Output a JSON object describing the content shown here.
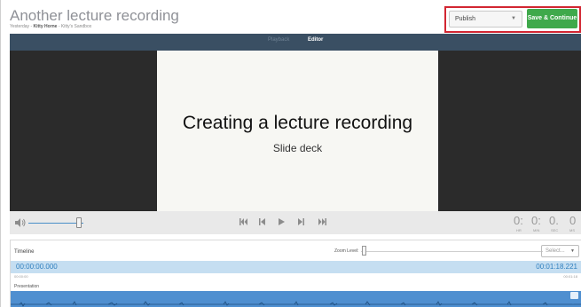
{
  "header": {
    "title": "Another lecture recording",
    "meta_when": "Yesterday",
    "meta_sep1": " - ",
    "meta_author": "Kitty Horne",
    "meta_sep2": " - ",
    "meta_folder": "Kitty's Sandbox"
  },
  "actions": {
    "publish_value": "Publish",
    "save_label": "Save & Continue"
  },
  "player": {
    "tabs": [
      "Playback",
      "Editor"
    ],
    "active_tab": "Editor",
    "slide_title": "Creating a lecture recording",
    "slide_subtitle": "Slide deck"
  },
  "controls": {
    "volume_level": 0.92,
    "time_hr": "0:",
    "time_min": "0:",
    "time_sec": "0.",
    "time_ms": "0",
    "label_hr": "HR",
    "label_min": "MIN",
    "label_sec": "SEC",
    "label_ms": "MS"
  },
  "timeline": {
    "label": "Timeline",
    "zoom_label": "Zoom Level:",
    "zoom_level": 0.0,
    "select_placeholder": "Select...",
    "start_time": "00:00:00.000",
    "end_time": "00:01:18.221",
    "start_small": "00:00:00",
    "end_small": "00:01:18",
    "presentation_label": "Presentation"
  },
  "colors": {
    "highlight_box": "#d22632",
    "save_button": "#3fa94b",
    "mode_bar": "#3a4f63",
    "timeline_bar": "#c5def1",
    "presentation_track": "#4f8fd0"
  }
}
